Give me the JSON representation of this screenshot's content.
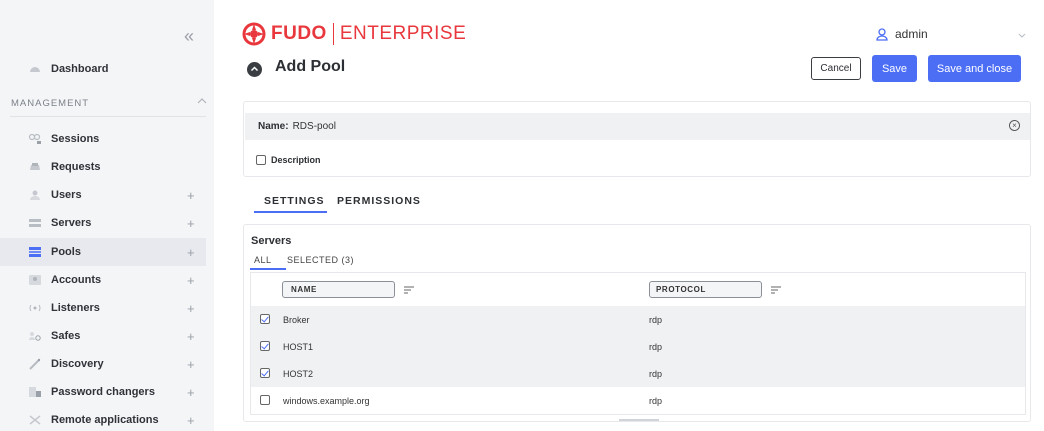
{
  "sidebar": {
    "collapse_glyph": "«",
    "dashboard": {
      "label": "Dashboard",
      "icon": "dashboard-icon"
    },
    "section": {
      "title": "MANAGEMENT"
    },
    "items": [
      {
        "label": "Sessions",
        "icon": "sessions-icon",
        "expandable": false
      },
      {
        "label": "Requests",
        "icon": "requests-icon",
        "expandable": false
      },
      {
        "label": "Users",
        "icon": "users-icon",
        "expandable": true
      },
      {
        "label": "Servers",
        "icon": "servers-icon",
        "expandable": true
      },
      {
        "label": "Pools",
        "icon": "pools-icon",
        "expandable": true,
        "active": true
      },
      {
        "label": "Accounts",
        "icon": "accounts-icon",
        "expandable": true
      },
      {
        "label": "Listeners",
        "icon": "listeners-icon",
        "expandable": true
      },
      {
        "label": "Safes",
        "icon": "safes-icon",
        "expandable": true
      },
      {
        "label": "Discovery",
        "icon": "discovery-icon",
        "expandable": true
      },
      {
        "label": "Password changers",
        "icon": "password-changers-icon",
        "expandable": true
      },
      {
        "label": "Remote applications",
        "icon": "remote-applications-icon",
        "expandable": true
      }
    ],
    "plus_glyph": "+"
  },
  "header": {
    "logo_brand": "FUDO",
    "logo_product": "ENTERPRISE",
    "user": "admin",
    "page_title": "Add Pool",
    "cancel_label": "Cancel",
    "save_label": "Save",
    "save_close_label": "Save and close"
  },
  "form": {
    "name_label": "Name:",
    "name_value": "RDS-pool",
    "description_label": "Description",
    "description_checked": false
  },
  "tabs": {
    "settings": "SETTINGS",
    "permissions": "PERMISSIONS",
    "active": "SETTINGS"
  },
  "servers": {
    "title": "Servers",
    "subtab_all": "ALL",
    "subtab_selected": "SELECTED (3)",
    "columns": {
      "name": "NAME",
      "protocol": "PROTOCOL"
    },
    "rows": [
      {
        "name": "Broker",
        "protocol": "rdp",
        "checked": true
      },
      {
        "name": "HOST1",
        "protocol": "rdp",
        "checked": true
      },
      {
        "name": "HOST2",
        "protocol": "rdp",
        "checked": true
      },
      {
        "name": "windows.example.org",
        "protocol": "rdp",
        "checked": false
      }
    ]
  },
  "colors": {
    "accent": "#4c6ef5",
    "brand": "#e8383d",
    "sidebar_bg": "#f4f5f7"
  }
}
